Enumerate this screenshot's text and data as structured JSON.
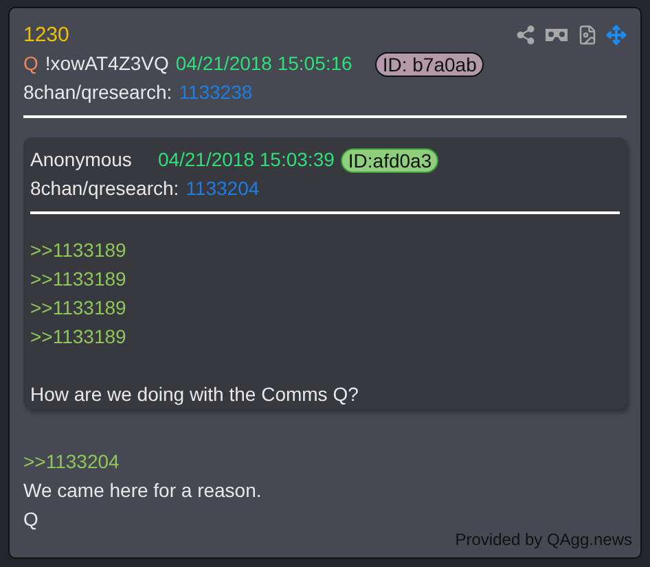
{
  "post": {
    "number": "1230",
    "author": "Q",
    "tripcode": "!xowAT4Z3VQ",
    "date": "04/21/2018 15:05:16",
    "id_badge": {
      "text": "ID: b7a0ab",
      "color": "#b39aa6"
    },
    "board": "8chan/qresearch:",
    "post_id": "1133238"
  },
  "quote": {
    "author": "Anonymous",
    "date": "04/21/2018 15:03:39",
    "id_badge": {
      "text": "ID:afd0a3",
      "color": "#8fce7d"
    },
    "board": "8chan/qresearch:",
    "post_id": "1133204",
    "paragraphs": [
      [
        {
          "kind": "reference",
          "text": ">>1133189"
        },
        {
          "kind": "reference",
          "text": ">>1133189"
        },
        {
          "kind": "reference",
          "text": ">>1133189"
        },
        {
          "kind": "reference",
          "text": ">>1133189"
        }
      ],
      [
        {
          "kind": "text",
          "text": "How are we doing with the Comms Q?"
        }
      ]
    ]
  },
  "body": [
    {
      "kind": "reference",
      "text": ">>1133204"
    },
    {
      "kind": "text",
      "text": "We came here for a reason."
    },
    {
      "kind": "text",
      "text": "Q"
    }
  ],
  "footer": "Provided by QAgg.news"
}
